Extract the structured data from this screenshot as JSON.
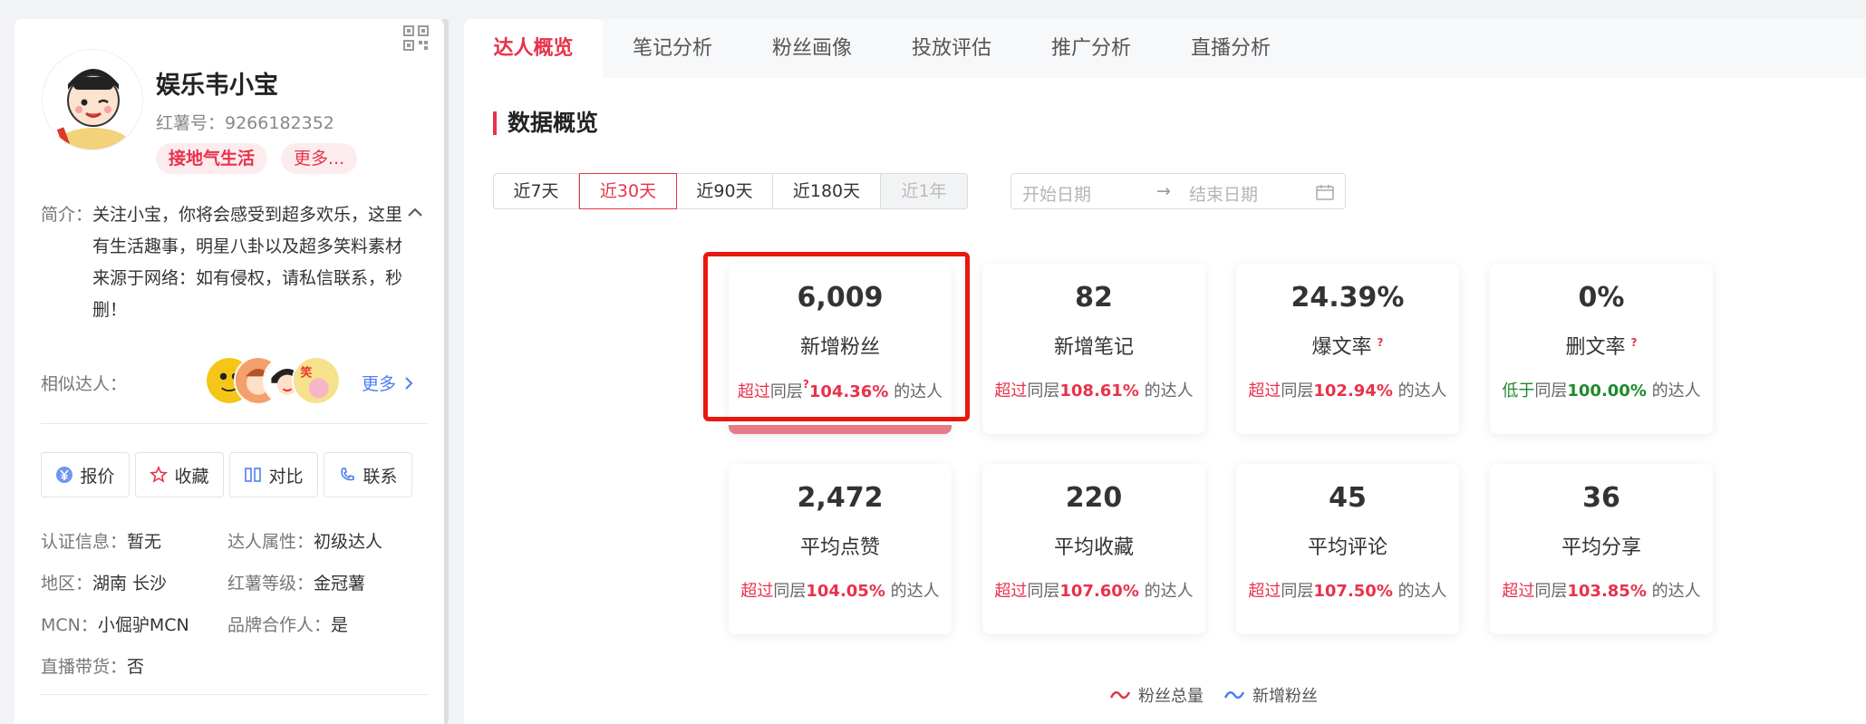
{
  "profile": {
    "name": "娱乐韦小宝",
    "redbook_id": "红薯号：9266182352",
    "tags": [
      "接地气生活",
      "更多..."
    ],
    "intro_label": "简介：",
    "intro_text": "关注小宝，你将会感受到超多欢乐，这里有生活趣事，明星八卦以及超多笑料素材来源于网络：如有侵权，请私信联系，秒删！",
    "similar_label": "相似达人：",
    "more_label": "更多",
    "actions": [
      {
        "label": "报价",
        "icon": "yuan-icon"
      },
      {
        "label": "收藏",
        "icon": "star-icon"
      },
      {
        "label": "对比",
        "icon": "compare-icon"
      },
      {
        "label": "联系",
        "icon": "phone-icon"
      }
    ],
    "info": [
      {
        "label": "认证信息：",
        "value": "暂无"
      },
      {
        "label": "达人属性：",
        "value": "初级达人"
      },
      {
        "label": "地区：",
        "value": "湖南 长沙"
      },
      {
        "label": "红薯等级：",
        "value": "金冠薯"
      },
      {
        "label": "MCN：",
        "value": "小倔驴MCN"
      },
      {
        "label": "品牌合作人：",
        "value": "是"
      },
      {
        "label": "直播带货：",
        "value": "否"
      }
    ]
  },
  "tabs": [
    "达人概览",
    "笔记分析",
    "粉丝画像",
    "投放评估",
    "推广分析",
    "直播分析"
  ],
  "active_tab": "达人概览",
  "section_title": "数据概览",
  "ranges": [
    "近7天",
    "近30天",
    "近90天",
    "近180天",
    "近1年"
  ],
  "active_range": "近30天",
  "date_range": {
    "start_placeholder": "开始日期",
    "end_placeholder": "结束日期",
    "arrow": "→"
  },
  "stats": [
    {
      "value": "6,009",
      "label": "新增粉丝",
      "cmp_word": "超过",
      "cmp_mid": "同层",
      "pct": "104.36%",
      "suffix": "的达人",
      "help": "?",
      "help_pos": "cmp"
    },
    {
      "value": "82",
      "label": "新增笔记",
      "cmp_word": "超过",
      "cmp_mid": "同层",
      "pct": "108.61%",
      "suffix": "的达人"
    },
    {
      "value": "24.39%",
      "label": "爆文率",
      "cmp_word": "超过",
      "cmp_mid": "同层",
      "pct": "102.94%",
      "suffix": "的达人",
      "help": "?"
    },
    {
      "value": "0%",
      "label": "删文率",
      "cmp_word": "低于",
      "cmp_mid": "同层",
      "pct": "100.00%",
      "suffix": "的达人",
      "help": "?",
      "green": true
    },
    {
      "value": "2,472",
      "label": "平均点赞",
      "cmp_word": "超过",
      "cmp_mid": "同层",
      "pct": "104.05%",
      "suffix": "的达人"
    },
    {
      "value": "220",
      "label": "平均收藏",
      "cmp_word": "超过",
      "cmp_mid": "同层",
      "pct": "107.60%",
      "suffix": "的达人"
    },
    {
      "value": "45",
      "label": "平均评论",
      "cmp_word": "超过",
      "cmp_mid": "同层",
      "pct": "107.50%",
      "suffix": "的达人"
    },
    {
      "value": "36",
      "label": "平均分享",
      "cmp_word": "超过",
      "cmp_mid": "同层",
      "pct": "103.85%",
      "suffix": "的达人"
    }
  ],
  "legend": [
    {
      "label": "粉丝总量",
      "color": "#e8324b"
    },
    {
      "label": "新增粉丝",
      "color": "#4c7ef3"
    }
  ],
  "colors": {
    "accent": "#e8324b",
    "link": "#4c7ef3",
    "positive": "#1f8a2a",
    "highlight": "#e8180e"
  }
}
